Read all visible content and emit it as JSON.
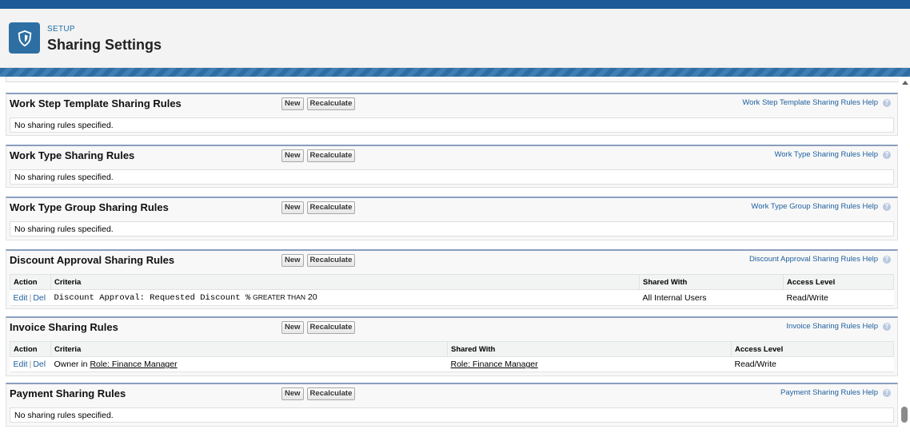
{
  "header": {
    "breadcrumb": "SETUP",
    "title": "Sharing Settings"
  },
  "buttons": {
    "new": "New",
    "recalc": "Recalculate"
  },
  "empty_text": "No sharing rules specified.",
  "prev_section_fragment": "...",
  "sections": [
    {
      "title": "Work Step Template Sharing Rules",
      "help": "Work Step Template Sharing Rules Help"
    },
    {
      "title": "Work Type Sharing Rules",
      "help": "Work Type Sharing Rules Help"
    },
    {
      "title": "Work Type Group Sharing Rules",
      "help": "Work Type Group Sharing Rules Help"
    },
    {
      "title": "Discount Approval Sharing Rules",
      "help": "Discount Approval Sharing Rules Help",
      "columns": [
        "Action",
        "Criteria",
        "Shared With",
        "Access Level"
      ],
      "row": {
        "edit": "Edit",
        "del": "Del",
        "criteria_field": "Discount Approval: Requested Discount %",
        "criteria_op": "GREATER THAN",
        "criteria_value": "20",
        "shared_with": "All Internal Users",
        "access": "Read/Write"
      }
    },
    {
      "title": "Invoice Sharing Rules",
      "help": "Invoice Sharing Rules Help",
      "columns": [
        "Action",
        "Criteria",
        "Shared With",
        "Access Level"
      ],
      "row": {
        "edit": "Edit",
        "del": "Del",
        "criteria_prefix": "Owner in",
        "criteria_link": "Role: Finance Manager",
        "shared_with": "Role: Finance Manager",
        "access": "Read/Write"
      }
    },
    {
      "title": "Payment Sharing Rules",
      "help": "Payment Sharing Rules Help"
    }
  ],
  "help_icon_text": "?",
  "icons": {
    "logo": "shield-icon",
    "help": "help-icon"
  }
}
